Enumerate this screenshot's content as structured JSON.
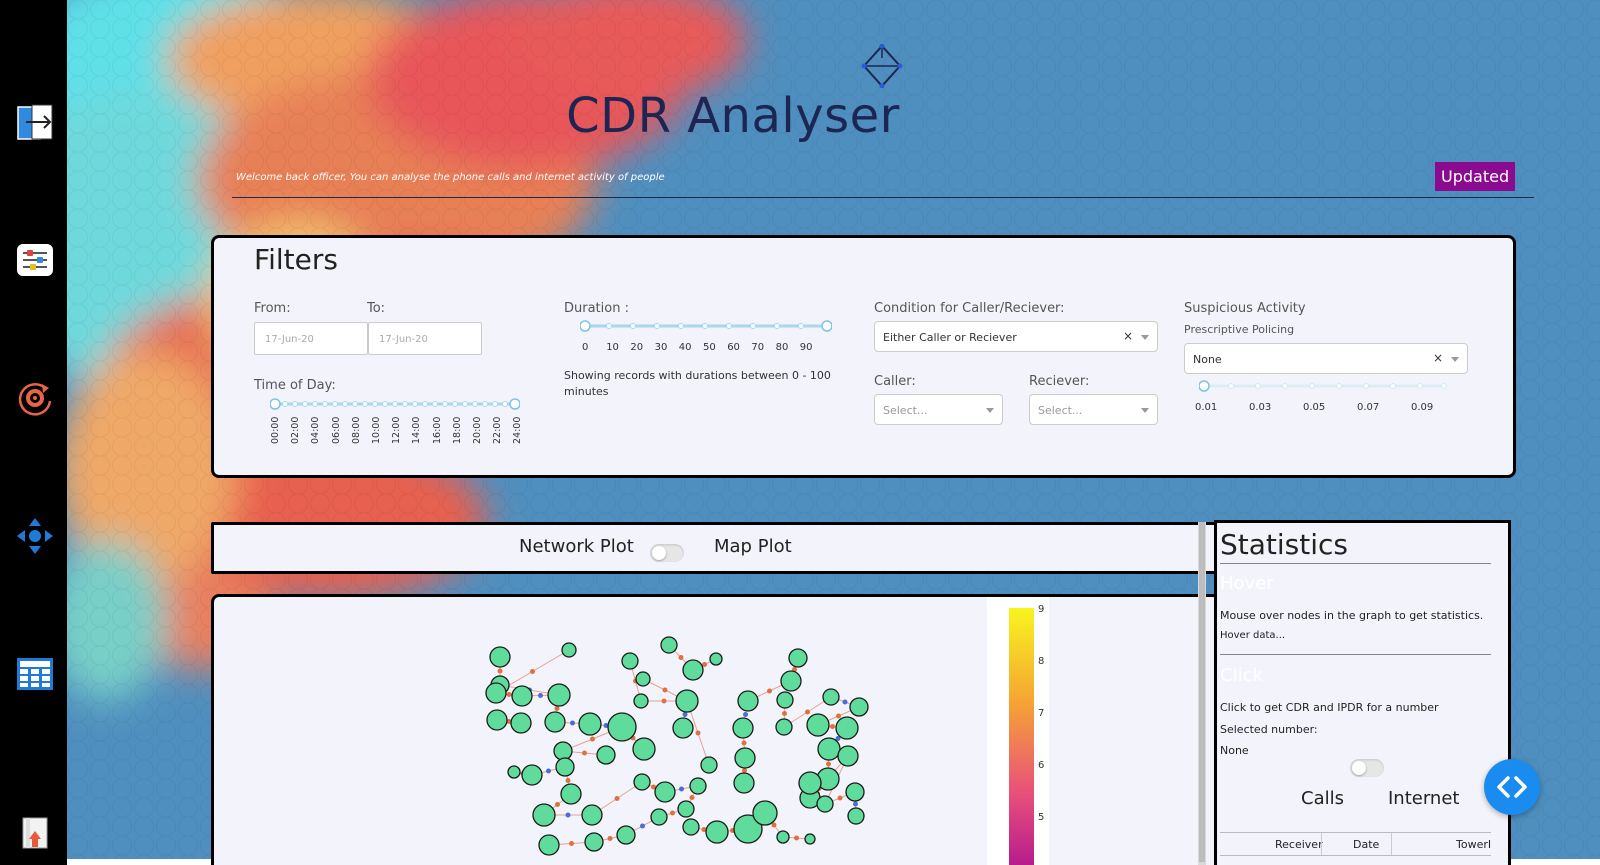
{
  "app": {
    "title": "CDR Analyser",
    "welcome": "Welcome back officer, You can analyse the phone calls and internet activity of people",
    "status_badge": "Updated"
  },
  "sidebar": {
    "items": [
      {
        "icon": "logout-icon"
      },
      {
        "icon": "sliders-icon"
      },
      {
        "icon": "refresh-target-icon"
      },
      {
        "icon": "move-arrows-icon"
      },
      {
        "icon": "table-icon"
      },
      {
        "icon": "upload-file-icon"
      }
    ]
  },
  "filters": {
    "heading": "Filters",
    "from_label": "From:",
    "to_label": "To:",
    "from_placeholder": "17-Jun-20",
    "to_placeholder": "17-Jun-20",
    "time_of_day_label": "Time of Day:",
    "time_ticks": [
      "00:00",
      "02:00",
      "04:00",
      "06:00",
      "08:00",
      "10:00",
      "12:00",
      "14:00",
      "16:00",
      "18:00",
      "20:00",
      "22:00",
      "24:00"
    ],
    "duration_label": "Duration :",
    "duration_ticks": [
      "0",
      "10",
      "20",
      "30",
      "40",
      "50",
      "60",
      "70",
      "80",
      "90"
    ],
    "duration_note": "Showing records with durations between 0 - 100 minutes",
    "condition_label": "Condition for Caller/Reciever:",
    "condition_value": "Either Caller or Reciever",
    "caller_label": "Caller:",
    "caller_placeholder": "Select...",
    "reciever_label": "Reciever:",
    "reciever_placeholder": "Select...",
    "suspicious_label": "Suspicious Activity",
    "policing_label": "Prescriptive Policing",
    "policing_value": "None",
    "policing_ticks": [
      "0.01",
      "0.03",
      "0.05",
      "0.07",
      "0.09"
    ],
    "clear_symbol": "×"
  },
  "plot_toggle": {
    "left_label": "Network Plot",
    "right_label": "Map Plot"
  },
  "colorbar": {
    "ticks": [
      "9",
      "8",
      "7",
      "6",
      "5"
    ]
  },
  "statistics": {
    "heading": "Statistics",
    "hover_heading": "Hover",
    "hover_text": "Mouse over nodes in the graph to get statistics.",
    "hover_data": "Hover data...",
    "click_heading": "Click",
    "click_text": "Click to get CDR and IPDR for a number",
    "selected_label": "Selected number:",
    "selected_value": "None",
    "calls_label": "Calls",
    "internet_label": "Internet",
    "table_headers": [
      "Receiver",
      "Date",
      "TowerI"
    ]
  },
  "colors": {
    "sidebar": "#000000",
    "background": "#4d8dbd",
    "panel": "#f3f4fb",
    "badge": "#8b0a8f",
    "title": "#1d2552",
    "node": "#5fdc9c",
    "fab": "#1a8cf0"
  }
}
